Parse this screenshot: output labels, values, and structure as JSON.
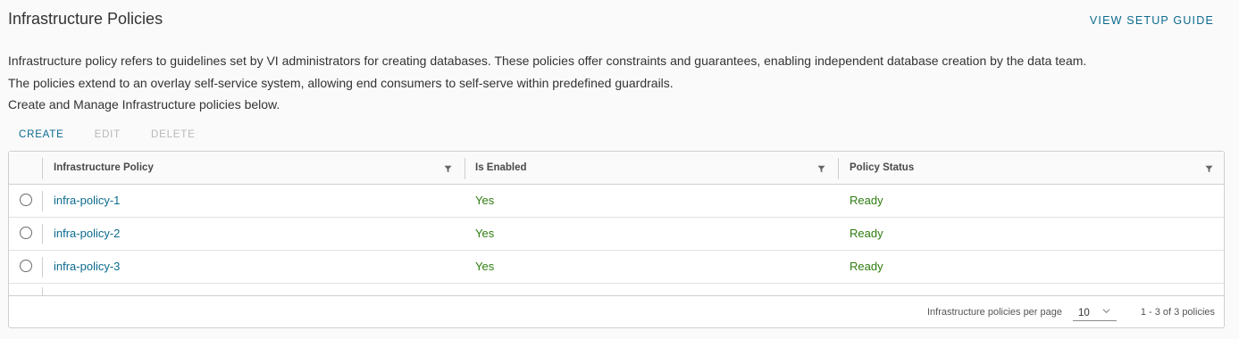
{
  "header": {
    "title": "Infrastructure Policies",
    "setup_guide_label": "VIEW SETUP GUIDE"
  },
  "description": {
    "line1": "Infrastructure policy refers to guidelines set by VI administrators for creating databases. These policies offer constraints and guarantees, enabling independent database creation by the data team.",
    "line2": "The policies extend to an overlay self-service system, allowing end consumers to self-serve within predefined guardrails.",
    "line3": "Create and Manage Infrastructure policies below."
  },
  "actions": {
    "create": "CREATE",
    "edit": "EDIT",
    "delete": "DELETE"
  },
  "table": {
    "columns": [
      "Infrastructure Policy",
      "Is Enabled",
      "Policy Status"
    ],
    "rows": [
      {
        "policy": "infra-policy-1",
        "enabled": "Yes",
        "status": "Ready"
      },
      {
        "policy": "infra-policy-2",
        "enabled": "Yes",
        "status": "Ready"
      },
      {
        "policy": "infra-policy-3",
        "enabled": "Yes",
        "status": "Ready"
      }
    ]
  },
  "footer": {
    "per_page_label": "Infrastructure policies per page",
    "per_page_value": "10",
    "range_label": "1 - 3 of 3 policies"
  },
  "colors": {
    "accent": "#0b6a8d",
    "success": "#2f7d10",
    "disabled": "#b8b8b8"
  },
  "icons": {
    "filter": "filter-icon",
    "chevron": "chevron-down-icon",
    "radio": "radio-button"
  }
}
